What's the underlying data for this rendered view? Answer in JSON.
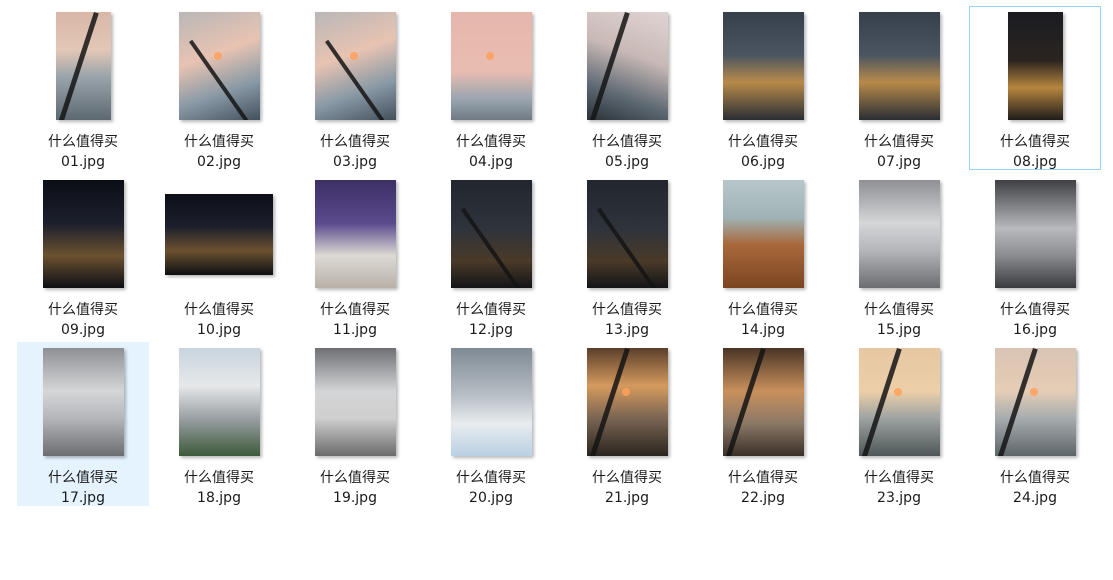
{
  "files": [
    {
      "name_line1": "什么值得买",
      "name_line2": "01.jpg",
      "shape": "portrait-narrow",
      "art": "art-dusk-window",
      "icon": "photo-thumbnail-icon"
    },
    {
      "name_line1": "什么值得买",
      "name_line2": "02.jpg",
      "shape": "portrait",
      "art": "art-dusk-building",
      "icon": "photo-thumbnail-icon"
    },
    {
      "name_line1": "什么值得买",
      "name_line2": "03.jpg",
      "shape": "portrait",
      "art": "art-dusk-building",
      "icon": "photo-thumbnail-icon"
    },
    {
      "name_line1": "什么值得买",
      "name_line2": "04.jpg",
      "shape": "portrait",
      "art": "art-pink-sky",
      "icon": "photo-thumbnail-icon"
    },
    {
      "name_line1": "什么值得买",
      "name_line2": "05.jpg",
      "shape": "portrait",
      "art": "art-tilt-dusk",
      "icon": "photo-thumbnail-icon"
    },
    {
      "name_line1": "什么值得买",
      "name_line2": "06.jpg",
      "shape": "portrait",
      "art": "art-night-apron",
      "icon": "photo-thumbnail-icon"
    },
    {
      "name_line1": "什么值得买",
      "name_line2": "07.jpg",
      "shape": "portrait",
      "art": "art-night-apron",
      "icon": "photo-thumbnail-icon"
    },
    {
      "name_line1": "什么值得买",
      "name_line2": "08.jpg",
      "shape": "portrait-narrow",
      "art": "art-dark-night",
      "icon": "photo-thumbnail-icon",
      "focused": true
    },
    {
      "name_line1": "什么值得买",
      "name_line2": "09.jpg",
      "shape": "portrait",
      "art": "art-city-night",
      "icon": "photo-thumbnail-icon"
    },
    {
      "name_line1": "什么值得买",
      "name_line2": "10.jpg",
      "shape": "landscape",
      "art": "art-city-night",
      "icon": "photo-thumbnail-icon"
    },
    {
      "name_line1": "什么值得买",
      "name_line2": "11.jpg",
      "shape": "portrait",
      "art": "art-cabin",
      "icon": "photo-thumbnail-icon"
    },
    {
      "name_line1": "什么值得买",
      "name_line2": "12.jpg",
      "shape": "portrait",
      "art": "art-wing-dark",
      "icon": "photo-thumbnail-icon"
    },
    {
      "name_line1": "什么值得买",
      "name_line2": "13.jpg",
      "shape": "portrait",
      "art": "art-wing-dark",
      "icon": "photo-thumbnail-icon"
    },
    {
      "name_line1": "什么值得买",
      "name_line2": "14.jpg",
      "shape": "portrait",
      "art": "art-table",
      "icon": "photo-thumbnail-icon"
    },
    {
      "name_line1": "什么值得买",
      "name_line2": "15.jpg",
      "shape": "portrait",
      "art": "art-terminal",
      "icon": "photo-thumbnail-icon"
    },
    {
      "name_line1": "什么值得买",
      "name_line2": "16.jpg",
      "shape": "portrait",
      "art": "art-terminal-dark",
      "icon": "photo-thumbnail-icon"
    },
    {
      "name_line1": "什么值得买",
      "name_line2": "17.jpg",
      "shape": "portrait",
      "art": "art-terminal",
      "icon": "photo-thumbnail-icon",
      "selected": true
    },
    {
      "name_line1": "什么值得买",
      "name_line2": "18.jpg",
      "shape": "portrait",
      "art": "art-glass-roof",
      "icon": "photo-thumbnail-icon"
    },
    {
      "name_line1": "什么值得买",
      "name_line2": "19.jpg",
      "shape": "portrait",
      "art": "art-hall",
      "icon": "photo-thumbnail-icon"
    },
    {
      "name_line1": "什么值得买",
      "name_line2": "20.jpg",
      "shape": "portrait",
      "art": "art-ticket",
      "icon": "photo-thumbnail-icon"
    },
    {
      "name_line1": "什么值得买",
      "name_line2": "21.jpg",
      "shape": "portrait",
      "art": "art-sunset",
      "icon": "photo-thumbnail-icon"
    },
    {
      "name_line1": "什么值得买",
      "name_line2": "22.jpg",
      "shape": "portrait",
      "art": "art-sunset-frame",
      "icon": "photo-thumbnail-icon"
    },
    {
      "name_line1": "什么值得买",
      "name_line2": "23.jpg",
      "shape": "portrait",
      "art": "art-sunset-apron",
      "icon": "photo-thumbnail-icon"
    },
    {
      "name_line1": "什么值得买",
      "name_line2": "24.jpg",
      "shape": "portrait",
      "art": "art-sunset-gate",
      "icon": "photo-thumbnail-icon"
    }
  ],
  "colors": {
    "selection_fill": "#e5f3ff",
    "focus_border": "#99d1ff",
    "text": "#1a1a1a"
  }
}
